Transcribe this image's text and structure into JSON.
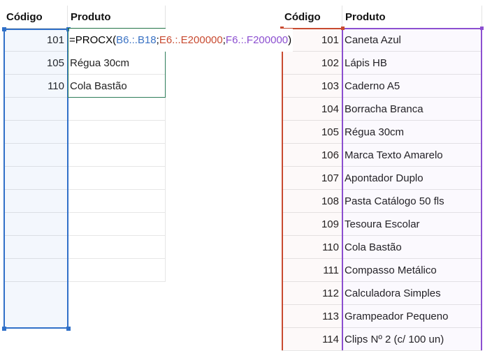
{
  "left_table": {
    "header_code": "Código",
    "header_product": "Produto",
    "rows": [
      {
        "code": "101",
        "product": ""
      },
      {
        "code": "105",
        "product": "Régua 30cm"
      },
      {
        "code": "110",
        "product": "Cola Bastão"
      },
      {
        "code": "",
        "product": ""
      },
      {
        "code": "",
        "product": ""
      },
      {
        "code": "",
        "product": ""
      },
      {
        "code": "",
        "product": ""
      },
      {
        "code": "",
        "product": ""
      },
      {
        "code": "",
        "product": ""
      },
      {
        "code": "",
        "product": ""
      },
      {
        "code": "",
        "product": ""
      }
    ]
  },
  "formula": {
    "func": "=PROCX(",
    "arg1": "B6.:.B18",
    "sep1": ";",
    "arg2": "E6.:.E200000",
    "sep2": ";",
    "arg3": "F6.:.F200000",
    "close": ")"
  },
  "right_table": {
    "header_code": "Código",
    "header_product": "Produto",
    "rows": [
      {
        "code": "101",
        "product": "Caneta Azul"
      },
      {
        "code": "102",
        "product": "Lápis HB"
      },
      {
        "code": "103",
        "product": "Caderno A5"
      },
      {
        "code": "104",
        "product": "Borracha Branca"
      },
      {
        "code": "105",
        "product": "Régua 30cm"
      },
      {
        "code": "106",
        "product": "Marca Texto Amarelo"
      },
      {
        "code": "107",
        "product": "Apontador Duplo"
      },
      {
        "code": "108",
        "product": "Pasta Catálogo 50 fls"
      },
      {
        "code": "109",
        "product": "Tesoura Escolar"
      },
      {
        "code": "110",
        "product": "Cola Bastão"
      },
      {
        "code": "111",
        "product": "Compasso Metálico"
      },
      {
        "code": "112",
        "product": "Calculadora Simples"
      },
      {
        "code": "113",
        "product": "Grampeador Pequeno"
      },
      {
        "code": "114",
        "product": "Clips Nº 2 (c/ 100 un)"
      }
    ]
  },
  "colors": {
    "lookup_range": "#3070c8",
    "return_code_range": "#c84a30",
    "return_product_range": "#8c4fd0",
    "active_cell": "#217346"
  }
}
